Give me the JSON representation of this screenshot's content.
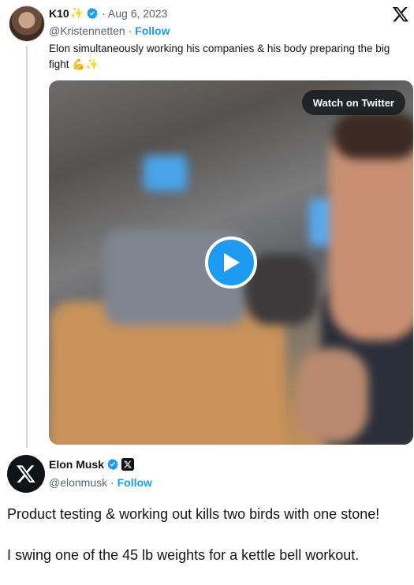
{
  "quoted_tweet": {
    "display_name": "K10",
    "name_emoji": "✨",
    "date": "Aug 6, 2023",
    "handle": "@Kristennetten",
    "follow_label": "Follow",
    "text": "Elon simultaneously working his companies & his body preparing the big fight 💪✨",
    "watch_label": "Watch on Twitter",
    "icons": {
      "avatar": "profile-avatar",
      "verified": "verified-badge-icon",
      "logo": "x-logo-icon",
      "play": "play-icon"
    }
  },
  "main_tweet": {
    "display_name": "Elon Musk",
    "handle": "@elonmusk",
    "follow_label": "Follow",
    "paragraphs": [
      "Product testing & working out kills two birds with one stone!",
      "I swing one of the 45 lb weights for a kettle bell workout."
    ],
    "icons": {
      "avatar": "x-logo-avatar",
      "verified": "verified-badge-icon",
      "affiliate": "x-affiliate-badge-icon"
    }
  },
  "colors": {
    "accent": "#1d9bf0",
    "text": "#0f1419",
    "muted": "#536471",
    "divider": "#cfd9de"
  }
}
